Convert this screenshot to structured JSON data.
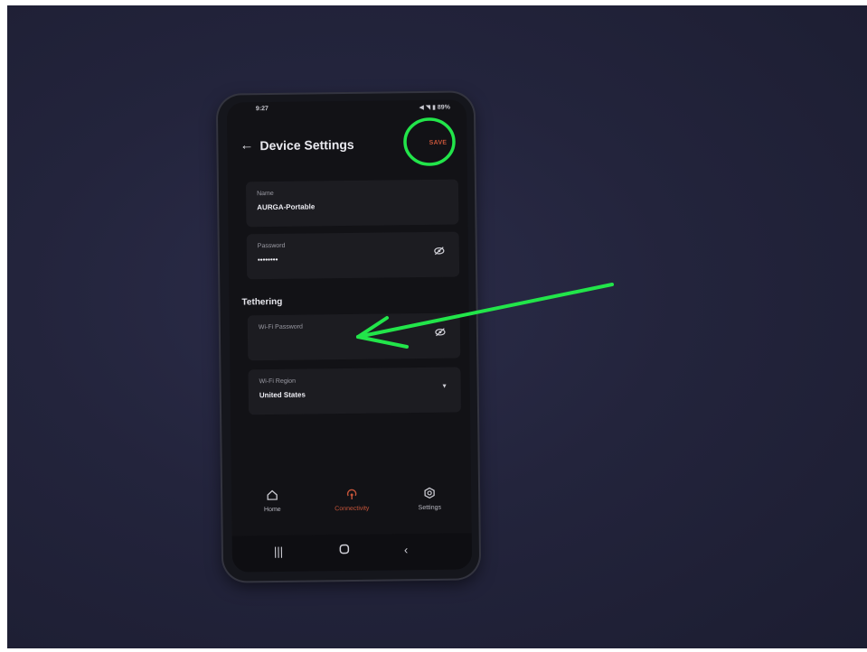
{
  "status_bar": {
    "time": "9:27",
    "icons": "◀ ◥ ▮ 89%"
  },
  "header": {
    "title": "Device Settings",
    "back_icon": "back-arrow-icon",
    "save_label": "SAVE"
  },
  "fields": [
    {
      "label": "Name",
      "value": "AURGA-Portable",
      "icon": ""
    },
    {
      "label": "Password",
      "value": "••••••••",
      "icon": "eye-off-icon"
    }
  ],
  "tethering": {
    "section_title": "Tethering",
    "wifi_password": {
      "label": "Wi-Fi Password",
      "value": "",
      "icon": "eye-off-icon"
    },
    "wifi_region": {
      "label": "Wi-Fi Region",
      "value": "United States",
      "icon": "chevron-down-icon"
    }
  },
  "bottom_nav": [
    {
      "label": "Home",
      "icon": "home-icon",
      "active": false
    },
    {
      "label": "Connectivity",
      "icon": "connectivity-icon",
      "active": true
    },
    {
      "label": "Settings",
      "icon": "settings-icon",
      "active": false
    }
  ],
  "system_nav": {
    "recents_icon": "recents-icon",
    "home_icon": "home-circle-icon",
    "back_icon": "back-chevron-icon"
  },
  "colors": {
    "accent": "#c7553a",
    "annotation": "#22e54a",
    "background": "#23243c",
    "card": "#1c1c21"
  }
}
